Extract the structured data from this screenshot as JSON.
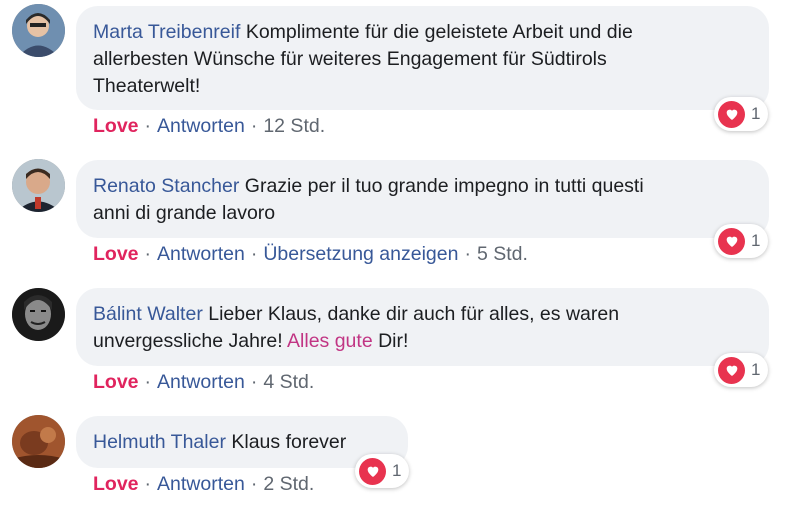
{
  "colors": {
    "author": "#385898",
    "love": "#e0245e",
    "tag": "#c13584",
    "bubble": "#f0f2f5"
  },
  "comments": [
    {
      "author": "Marta Treibenreif",
      "text_lines": [
        "Komplimente für die geleistete Arbeit und die",
        "allerbesten Wünsche für weiteres Engagement für Südtirols",
        "Theaterwelt!"
      ],
      "love_label": "Love",
      "reply_label": "Antworten",
      "time": "12 Std.",
      "reaction_icon": "heart-icon",
      "reaction_count": "1"
    },
    {
      "author": "Renato Stancher",
      "text_lines": [
        "Grazie per il tuo grande impegno in tutti questi",
        "anni di grande lavoro"
      ],
      "love_label": "Love",
      "reply_label": "Antworten",
      "translate_label": "Übersetzung anzeigen",
      "time": "5 Std.",
      "reaction_icon": "heart-icon",
      "reaction_count": "1"
    },
    {
      "author": "Bálint Walter",
      "text_line1": "Lieber Klaus, danke dir auch für alles, es waren",
      "text_line2_pre": "unvergessliche Jahre!",
      "text_tag": "Alles gute",
      "text_line2_post": "Dir!",
      "love_label": "Love",
      "reply_label": "Antworten",
      "time": "4 Std.",
      "reaction_icon": "heart-icon",
      "reaction_count": "1"
    },
    {
      "author": "Helmuth Thaler",
      "text_lines": [
        "Klaus forever"
      ],
      "love_label": "Love",
      "reply_label": "Antworten",
      "time": "2 Std.",
      "reaction_icon": "heart-icon",
      "reaction_count": "1"
    }
  ]
}
